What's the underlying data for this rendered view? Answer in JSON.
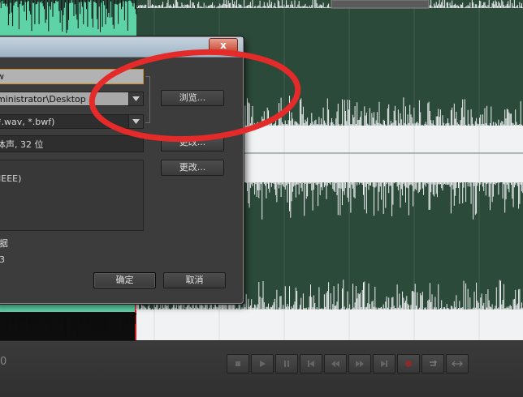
{
  "dialog": {
    "filename_value": "w",
    "location_value": "ministrator\\Desktop",
    "format_value": "*.wav, *.bwf)",
    "sample_type_value": "体声, 32 位",
    "browse_label": "浏览...",
    "change_label_1": "更改...",
    "change_label_2": "更改...",
    "format_settings_value": "IEEE)",
    "metadata_label": "据",
    "size_label": "3",
    "ok_label": "确定",
    "cancel_label": "取消",
    "close_glyph": "x"
  },
  "colors": {
    "waveform_bg": "#2c4a3a",
    "waveform_fill": "#f0f2f4",
    "waveform_selected_bg": "#5fd3a8",
    "annotation_circle": "#e52a2a"
  },
  "transport": {
    "time_edge": "0",
    "buttons": [
      "stop-icon",
      "play-icon",
      "pause-icon",
      "go-to-start-icon",
      "rewind-icon",
      "fast-forward-icon",
      "go-to-end-icon",
      "record-icon",
      "loop-icon",
      "skip-icon"
    ]
  }
}
